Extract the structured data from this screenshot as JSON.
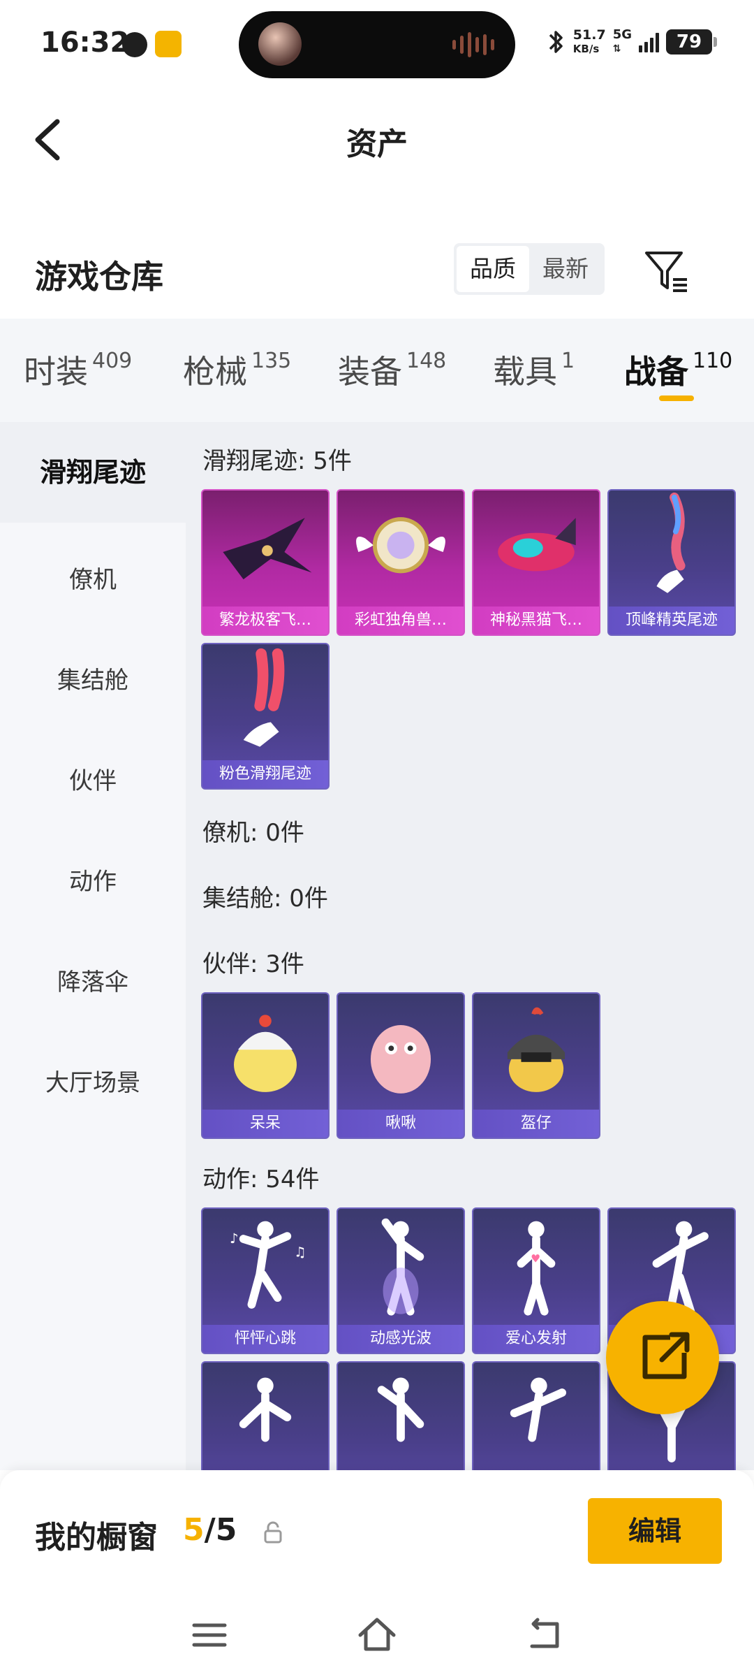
{
  "status_bar": {
    "time": "16:32",
    "speed_value": "51.7",
    "speed_unit": "KB/s",
    "network": "5G",
    "battery": "79"
  },
  "header": {
    "title": "资产"
  },
  "warehouse": {
    "title": "游戏仓库",
    "sort_options": [
      "品质",
      "最新"
    ],
    "active_sort": "品质"
  },
  "tabs": [
    {
      "label": "时装",
      "count": "409"
    },
    {
      "label": "枪械",
      "count": "135"
    },
    {
      "label": "装备",
      "count": "148"
    },
    {
      "label": "载具",
      "count": "1"
    },
    {
      "label": "战备",
      "count": "110"
    }
  ],
  "sidebar": {
    "items": [
      "滑翔尾迹",
      "僚机",
      "集结舱",
      "伙伴",
      "动作",
      "降落伞",
      "大厅场景"
    ]
  },
  "sections": [
    {
      "title": "滑翔尾迹: 5件",
      "items": [
        "繁龙极客飞…",
        "彩虹独角兽…",
        "神秘黑猫飞…",
        "顶峰精英尾迹",
        "粉色滑翔尾迹"
      ]
    },
    {
      "title": "僚机: 0件",
      "items": []
    },
    {
      "title": "集结舱: 0件",
      "items": []
    },
    {
      "title": "伙伴: 3件",
      "items": [
        "呆呆",
        "啾啾",
        "盔仔"
      ]
    },
    {
      "title": "动作: 54件",
      "items": [
        "怦怦心跳",
        "动感光波",
        "爱心发射",
        ""
      ]
    }
  ],
  "bottom": {
    "window_label": "我的橱窗",
    "window_current": "5",
    "window_total": "/5",
    "edit_label": "编辑"
  },
  "colors": {
    "accent": "#f7b200",
    "pink_card": "#c832b6",
    "purple_card": "#5a4aa8"
  }
}
